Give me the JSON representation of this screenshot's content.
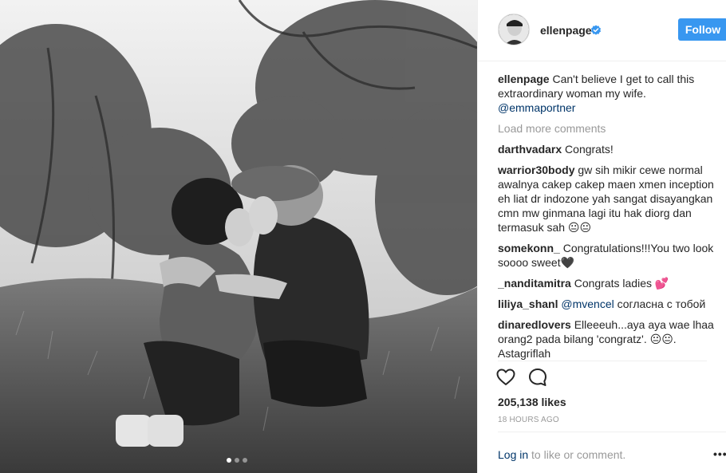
{
  "header": {
    "username": "ellenpage",
    "follow_label": "Follow"
  },
  "caption": {
    "username": "ellenpage",
    "text": "Can't believe I get to call this extraordinary woman my wife.",
    "mention": "@emmaportner"
  },
  "load_more_label": "Load more comments",
  "comments": [
    {
      "username": "darthvadarx",
      "text": "Congrats!"
    },
    {
      "username": "warrior30body",
      "text": "gw sih mikir cewe normal awalnya cakep cakep maen xmen inception eh liat dr indozone yah sangat disayangkan cmn mw ginmana lagi itu hak diorg dan termasuk sah 😐😐"
    },
    {
      "username": "somekonn_",
      "text": "Congratulations!!!You two look soooo sweet🖤"
    },
    {
      "username": "_nanditamitra",
      "text": "Congrats ladies 💕"
    },
    {
      "username": "liliya_shanl",
      "mention": "@mvencel",
      "text": "согласна с тобой"
    },
    {
      "username": "dinaredlovers",
      "text": "Elleeeuh...aya aya wae lhaa orang2 pada bilang 'congratz'. 😐😐. Astagriflah"
    }
  ],
  "likes_label": "205,138 likes",
  "time_label": "18 HOURS AGO",
  "login": {
    "link_text": "Log in",
    "rest_text": "to like or comment."
  },
  "more_label": "•••",
  "icons": {
    "verified": "verified-badge-icon",
    "like": "heart-icon",
    "comment": "comment-bubble-icon",
    "more": "more-options-icon"
  },
  "colors": {
    "accent": "#3897f0",
    "link": "#003569",
    "muted": "#999999",
    "text": "#262626"
  }
}
